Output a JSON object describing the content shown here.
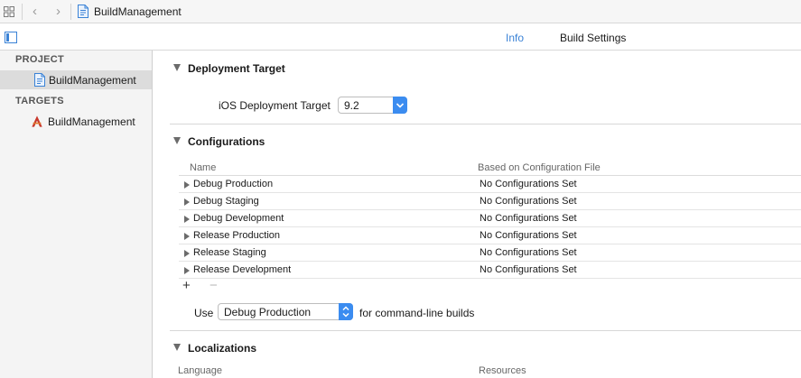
{
  "navbar": {
    "back_glyph": "‹",
    "forward_glyph": "›",
    "breadcrumb": "BuildManagement"
  },
  "tabs": [
    {
      "label": "Info",
      "selected": true
    },
    {
      "label": "Build Settings",
      "selected": false
    }
  ],
  "sidebar": {
    "project_header": "PROJECT",
    "project_item": "BuildManagement",
    "targets_header": "TARGETS",
    "target_item": "BuildManagement"
  },
  "deployment": {
    "title": "Deployment Target",
    "label": "iOS Deployment Target",
    "value": "9.2"
  },
  "configurations": {
    "title": "Configurations",
    "columns": [
      "Name",
      "Based on Configuration File"
    ],
    "rows": [
      {
        "name": "Debug Production",
        "file": "No Configurations Set"
      },
      {
        "name": "Debug Staging",
        "file": "No Configurations Set"
      },
      {
        "name": "Debug Development",
        "file": "No Configurations Set"
      },
      {
        "name": "Release Production",
        "file": "No Configurations Set"
      },
      {
        "name": "Release Staging",
        "file": "No Configurations Set"
      },
      {
        "name": "Release Development",
        "file": "No Configurations Set"
      }
    ],
    "add_glyph": "+",
    "remove_glyph": "−",
    "use_label": "Use",
    "use_value": "Debug Production",
    "use_suffix": "for command-line builds"
  },
  "localizations": {
    "title": "Localizations",
    "columns": [
      "Language",
      "Resources"
    ]
  },
  "colors": {
    "accent": "#3a82d6",
    "popup_blue": "#3b8cf0",
    "sidebar_bg": "#f4f4f4",
    "selected_bg": "#dcdcdc"
  },
  "icons": {
    "grid": "grid-icon",
    "back": "chevron-left-icon",
    "forward": "chevron-right-icon",
    "project_file": "project-file-icon",
    "target_app": "app-target-icon",
    "sidebar_toggle": "sidebar-toggle-icon"
  }
}
